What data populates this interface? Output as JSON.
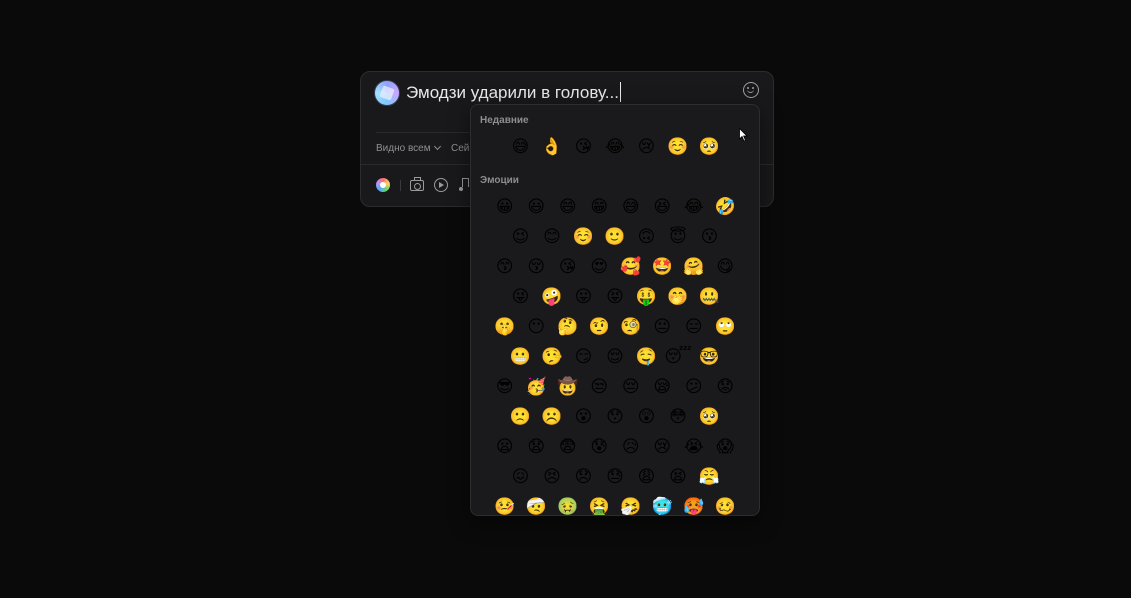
{
  "composer": {
    "text": "Эмодзи ударили в голову...",
    "visibility_label": "Видно всем",
    "schedule_label": "Сей"
  },
  "icons": {
    "avatar": "avatar-icon",
    "emoji_toggle": "smiley-icon",
    "color_background": "color-wheel-icon",
    "photo": "camera-icon",
    "video": "play-circle-icon",
    "music": "music-note-icon"
  },
  "picker": {
    "recent_title": "Недавние",
    "emotions_title": "Эмоции",
    "recent": [
      "😅",
      "👌",
      "😘",
      "😂",
      "😢",
      "☺️",
      "🥺"
    ],
    "emotions_rows": [
      [
        "😀",
        "😃",
        "😄",
        "😁",
        "😅",
        "😆",
        "😂",
        "🤣"
      ],
      [
        "😉",
        "😊",
        "☺️",
        "🙂",
        "🙃",
        "😇",
        "😗"
      ],
      [
        "😙",
        "😚",
        "😘",
        "😍",
        "🥰",
        "🤩",
        "🤗",
        "😋"
      ],
      [
        "😜",
        "🤪",
        "😛",
        "😝",
        "🤑",
        "🤭",
        "🤐"
      ],
      [
        "🤫",
        "😶",
        "🤔",
        "🤨",
        "🧐",
        "😐",
        "😑",
        "🙄"
      ],
      [
        "😬",
        "🤥",
        "😏",
        "😌",
        "🤤",
        "😴",
        "🤓"
      ],
      [
        "😎",
        "🥳",
        "🤠",
        "😒",
        "😔",
        "😪",
        "😕",
        "😟"
      ],
      [
        "🙁",
        "☹️",
        "😮",
        "😯",
        "😲",
        "😳",
        "🥺"
      ],
      [
        "😦",
        "😧",
        "😨",
        "😰",
        "😥",
        "😢",
        "😭",
        "😱"
      ],
      [
        "😖",
        "😣",
        "😞",
        "😓",
        "😩",
        "😫",
        "😤"
      ],
      [
        "🤒",
        "🤕",
        "🤢",
        "🤮",
        "🤧",
        "🥶",
        "🥵",
        "🥴"
      ]
    ]
  }
}
